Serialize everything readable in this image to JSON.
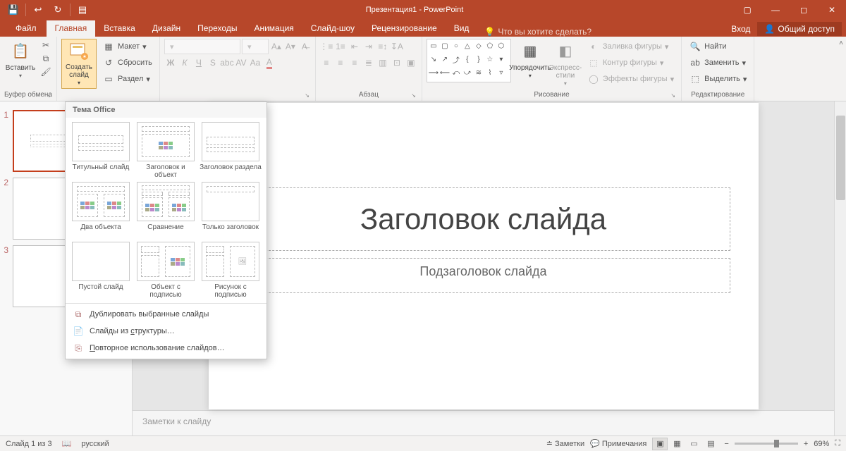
{
  "app_title": "Презентация1 - PowerPoint",
  "tabs": {
    "file": "Файл",
    "home": "Главная",
    "insert": "Вставка",
    "design": "Дизайн",
    "transitions": "Переходы",
    "animations": "Анимация",
    "slideshow": "Слайд-шоу",
    "review": "Рецензирование",
    "view": "Вид",
    "tellme": "Что вы хотите сделать?",
    "signin": "Вход",
    "share": "Общий доступ"
  },
  "ribbon": {
    "clipboard": {
      "paste": "Вставить",
      "label": "Буфер обмена"
    },
    "slides": {
      "new_slide": "Создать слайд",
      "layout": "Макет",
      "reset": "Сбросить",
      "section": "Раздел"
    },
    "paragraph_label": "Абзац",
    "drawing": {
      "label": "Рисование",
      "arrange": "Упорядочить",
      "quick_styles": "Экспресс-стили",
      "shape_fill": "Заливка фигуры",
      "shape_outline": "Контур фигуры",
      "shape_effects": "Эффекты фигуры"
    },
    "editing": {
      "label": "Редактирование",
      "find": "Найти",
      "replace": "Заменить",
      "select": "Выделить"
    }
  },
  "layout_dd": {
    "header": "Тема Office",
    "layouts": [
      "Титульный слайд",
      "Заголовок и объект",
      "Заголовок раздела",
      "Два объекта",
      "Сравнение",
      "Только заголовок",
      "Пустой слайд",
      "Объект с подписью",
      "Рисунок с подписью"
    ],
    "menu": {
      "duplicate": "Дублировать выбранные слайды",
      "from_outline": "Слайды из структуры…",
      "reuse": "Повторное использование слайдов…"
    }
  },
  "slide": {
    "title_placeholder": "Заголовок слайда",
    "subtitle_placeholder": "Подзаголовок слайда",
    "notes_placeholder": "Заметки к слайду"
  },
  "status": {
    "slide_of": "Слайд 1 из 3",
    "language": "русский",
    "notes": "Заметки",
    "comments": "Примечания",
    "zoom": "69%"
  },
  "thumbs": [
    "1",
    "2",
    "3"
  ]
}
